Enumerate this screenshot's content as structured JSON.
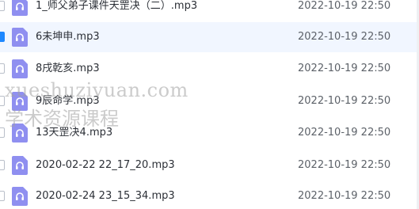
{
  "colors": {
    "icon_fill": "#8f8ff0",
    "selected_row_bg": "#f1f6ff",
    "checkbox_checked": "#1e88ff"
  },
  "files": [
    {
      "name": "1_师父弟子课件天罡决（二）.mp3",
      "date": "2022-10-19 22:50",
      "icon": "audio-file-icon",
      "selected": false
    },
    {
      "name": "6未坤申.mp3",
      "date": "2022-10-19 22:50",
      "icon": "audio-file-icon",
      "selected": true
    },
    {
      "name": "8戌乾亥.mp3",
      "date": "2022-10-19 22:50",
      "icon": "audio-file-icon",
      "selected": false
    },
    {
      "name": "9辰命学.mp3",
      "date": "2022-10-19 22:50",
      "icon": "audio-file-icon",
      "selected": false
    },
    {
      "name": "13天罡决4.mp3",
      "date": "2022-10-19 22:50",
      "icon": "audio-file-icon",
      "selected": false
    },
    {
      "name": "2020-02-22 22_17_20.mp3",
      "date": "2022-10-19 22:50",
      "icon": "audio-file-icon",
      "selected": false
    },
    {
      "name": "2020-02-24 23_15_34.mp3",
      "date": "2022-10-19 22:50",
      "icon": "audio-file-icon",
      "selected": false
    }
  ],
  "watermark": {
    "line1": "xueshuziyuan.com",
    "line2": "学术资源课程"
  }
}
